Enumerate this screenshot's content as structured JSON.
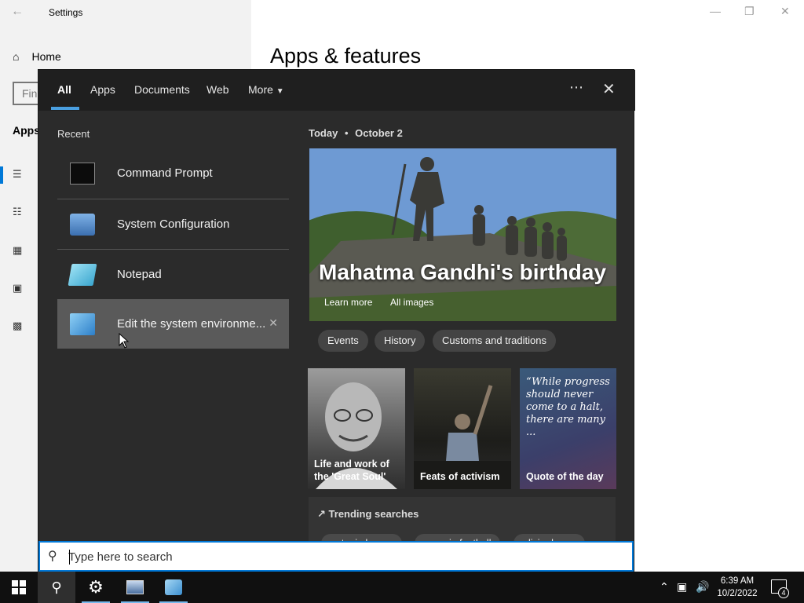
{
  "settings_window": {
    "title": "Settings",
    "home_label": "Home",
    "find_placeholder": "Fin",
    "apps_label": "Apps",
    "page_heading": "Apps & features"
  },
  "search_flyout": {
    "tabs": [
      {
        "label": "All",
        "active": true
      },
      {
        "label": "Apps",
        "active": false
      },
      {
        "label": "Documents",
        "active": false
      },
      {
        "label": "Web",
        "active": false
      },
      {
        "label": "More",
        "active": false
      }
    ],
    "more_icon": "ellipsis-icon",
    "close_icon": "close-icon",
    "recent": {
      "label": "Recent",
      "items": [
        {
          "label": "Command Prompt",
          "icon": "command-prompt-icon"
        },
        {
          "label": "System Configuration",
          "icon": "system-configuration-icon"
        },
        {
          "label": "Notepad",
          "icon": "notepad-icon"
        },
        {
          "label": "Edit the system environme...",
          "icon": "environment-variables-icon",
          "selected": true
        }
      ]
    },
    "today": {
      "prefix": "Today",
      "separator": "•",
      "date": "October 2"
    },
    "hero": {
      "title": "Mahatma Gandhi's birthday",
      "learn_more": "Learn more",
      "all_images": "All images"
    },
    "chips": [
      "Events",
      "History",
      "Customs and traditions"
    ],
    "cards": [
      {
        "caption": "Life and work of the 'Great Soul'"
      },
      {
        "caption": "Feats of activism"
      },
      {
        "caption": "Quote of the day",
        "quote": "“While progress should never come to a halt, there are many ..."
      }
    ],
    "trending": {
      "title": "Trending searches",
      "chips": [
        "antonio brown",
        "georgia football",
        "olivia dunne"
      ]
    },
    "search_box": {
      "placeholder": "Type here to search"
    }
  },
  "taskbar": {
    "clock_time": "6:39 AM",
    "clock_date": "10/2/2022",
    "notification_count": "4"
  }
}
